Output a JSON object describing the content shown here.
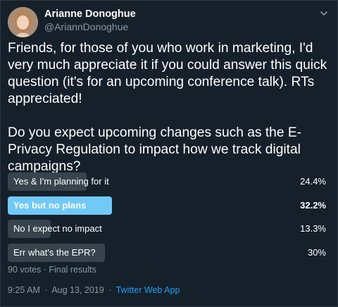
{
  "author": {
    "name": "Arianne Donoghue",
    "handle": "@AriannDonoghue"
  },
  "tweet": {
    "text": "Friends, for those of you who work in marketing, I'd very much appreciate it if you could answer this quick question (it's for an upcoming conference talk). RTs appreciated!\n\nDo you expect upcoming changes such as the E-Privacy Regulation to impact how we track digital campaigns?"
  },
  "poll": {
    "options": [
      {
        "label": "Yes & I'm planning for it",
        "percent_text": "24.4%",
        "percent": 24.4,
        "winner": false
      },
      {
        "label": "Yes but no plans",
        "percent_text": "32.2%",
        "percent": 32.2,
        "winner": true
      },
      {
        "label": "No I expect no impact",
        "percent_text": "13.3%",
        "percent": 13.3,
        "winner": false
      },
      {
        "label": "Err what's the EPR?",
        "percent_text": "30%",
        "percent": 30,
        "winner": false
      }
    ],
    "meta": "90 votes · Final results"
  },
  "footer": {
    "time": "9:25 AM",
    "separator": "·",
    "date": "Aug 13, 2019",
    "app": "Twitter Web App"
  },
  "colors": {
    "background": "#15202b",
    "bar": "#38444d",
    "winner_bar": "#71c9f8",
    "link": "#1da1f2",
    "muted": "#8899a6"
  }
}
